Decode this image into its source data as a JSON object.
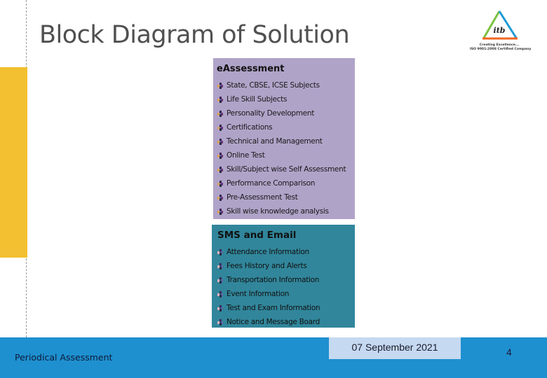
{
  "slide": {
    "title": "Block Diagram of Solution",
    "logo": {
      "name": "itb",
      "tagline": "Creating Excellence...",
      "certification": "ISO 9001:2008 Certified Company"
    },
    "eassessment": {
      "title": "eAssessment",
      "items": [
        "State, CBSE, ICSE Subjects",
        "Life Skill Subjects",
        "Personality Development",
        "Certifications",
        "Technical and Management",
        "Online Test",
        "Skill/Subject wise Self Assessment",
        "Performance Comparison",
        "Pre-Assessment Test",
        "Skill wise knowledge analysis"
      ]
    },
    "sms": {
      "title": "SMS and Email",
      "items": [
        "Attendance Information",
        "Fees History and Alerts",
        "Transportation Information",
        "Event Information",
        "Test and Exam Information",
        "Notice and Message Board"
      ]
    },
    "footer": {
      "left_text": "Periodical Assessment",
      "date": "07 September 2021",
      "page_number": "4"
    },
    "colors": {
      "accent_yellow": "#f2c031",
      "eassessment_box": "#b0a3c8",
      "sms_box": "#31869b",
      "footer": "#1e90cf",
      "date_box": "#c5d9f1"
    }
  }
}
